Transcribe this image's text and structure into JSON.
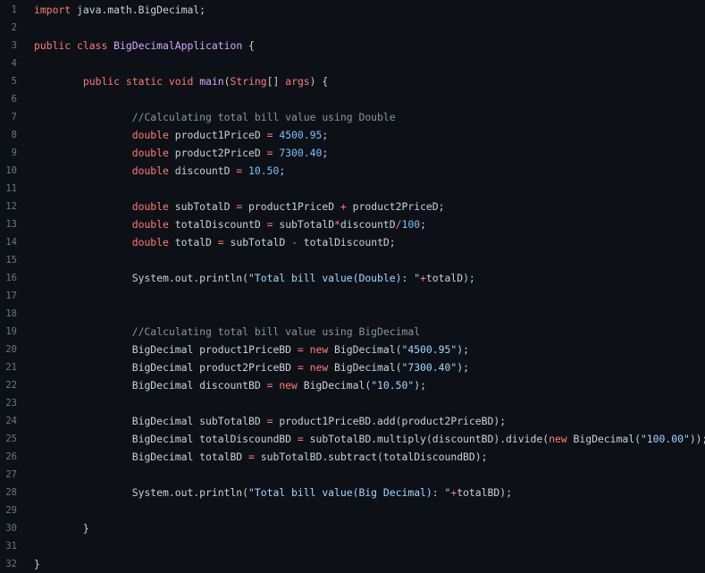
{
  "colors": {
    "background": "#0d1117",
    "text": "#c9d1d9",
    "keyword": "#ff7b72",
    "function": "#d2a8ff",
    "number": "#79c0ff",
    "string": "#a5d6ff",
    "comment": "#8b949e",
    "line_number": "#6e7681"
  },
  "lines": [
    {
      "n": "1",
      "tokens": [
        [
          "kw",
          "import"
        ],
        [
          "plain",
          " java.math.BigDecimal;"
        ]
      ]
    },
    {
      "n": "2",
      "tokens": []
    },
    {
      "n": "3",
      "tokens": [
        [
          "kw",
          "public"
        ],
        [
          "plain",
          " "
        ],
        [
          "kw",
          "class"
        ],
        [
          "plain",
          " "
        ],
        [
          "fn",
          "BigDecimalApplication"
        ],
        [
          "plain",
          " {"
        ]
      ]
    },
    {
      "n": "4",
      "tokens": []
    },
    {
      "n": "5",
      "tokens": [
        [
          "plain",
          "        "
        ],
        [
          "kw",
          "public"
        ],
        [
          "plain",
          " "
        ],
        [
          "kw",
          "static"
        ],
        [
          "plain",
          " "
        ],
        [
          "kw",
          "void"
        ],
        [
          "plain",
          " "
        ],
        [
          "fn",
          "main"
        ],
        [
          "plain",
          "("
        ],
        [
          "kw",
          "String"
        ],
        [
          "plain",
          "[] "
        ],
        [
          "kw",
          "args"
        ],
        [
          "plain",
          ") {"
        ]
      ]
    },
    {
      "n": "6",
      "tokens": []
    },
    {
      "n": "7",
      "tokens": [
        [
          "plain",
          "                "
        ],
        [
          "cm",
          "//Calculating total bill value using Double"
        ]
      ]
    },
    {
      "n": "8",
      "tokens": [
        [
          "plain",
          "                "
        ],
        [
          "kw",
          "double"
        ],
        [
          "plain",
          " product1PriceD "
        ],
        [
          "kw",
          "="
        ],
        [
          "plain",
          " "
        ],
        [
          "num",
          "4500.95"
        ],
        [
          "plain",
          ";"
        ]
      ]
    },
    {
      "n": "9",
      "tokens": [
        [
          "plain",
          "                "
        ],
        [
          "kw",
          "double"
        ],
        [
          "plain",
          " product2PriceD "
        ],
        [
          "kw",
          "="
        ],
        [
          "plain",
          " "
        ],
        [
          "num",
          "7300.40"
        ],
        [
          "plain",
          ";"
        ]
      ]
    },
    {
      "n": "10",
      "tokens": [
        [
          "plain",
          "                "
        ],
        [
          "kw",
          "double"
        ],
        [
          "plain",
          " discountD "
        ],
        [
          "kw",
          "="
        ],
        [
          "plain",
          " "
        ],
        [
          "num",
          "10.50"
        ],
        [
          "plain",
          ";"
        ]
      ]
    },
    {
      "n": "11",
      "tokens": []
    },
    {
      "n": "12",
      "tokens": [
        [
          "plain",
          "                "
        ],
        [
          "kw",
          "double"
        ],
        [
          "plain",
          " subTotalD "
        ],
        [
          "kw",
          "="
        ],
        [
          "plain",
          " product1PriceD "
        ],
        [
          "kw",
          "+"
        ],
        [
          "plain",
          " product2PriceD;"
        ]
      ]
    },
    {
      "n": "13",
      "tokens": [
        [
          "plain",
          "                "
        ],
        [
          "kw",
          "double"
        ],
        [
          "plain",
          " totalDiscountD "
        ],
        [
          "kw",
          "="
        ],
        [
          "plain",
          " subTotalD"
        ],
        [
          "kw",
          "*"
        ],
        [
          "plain",
          "discountD"
        ],
        [
          "kw",
          "/"
        ],
        [
          "num",
          "100"
        ],
        [
          "plain",
          ";"
        ]
      ]
    },
    {
      "n": "14",
      "tokens": [
        [
          "plain",
          "                "
        ],
        [
          "kw",
          "double"
        ],
        [
          "plain",
          " totalD "
        ],
        [
          "kw",
          "="
        ],
        [
          "plain",
          " subTotalD "
        ],
        [
          "kw",
          "-"
        ],
        [
          "plain",
          " totalDiscountD;"
        ]
      ]
    },
    {
      "n": "15",
      "tokens": []
    },
    {
      "n": "16",
      "tokens": [
        [
          "plain",
          "                System.out.println("
        ],
        [
          "str",
          "\"Total bill value(Double): \""
        ],
        [
          "kw",
          "+"
        ],
        [
          "plain",
          "totalD);"
        ]
      ]
    },
    {
      "n": "17",
      "tokens": []
    },
    {
      "n": "18",
      "tokens": []
    },
    {
      "n": "19",
      "tokens": [
        [
          "plain",
          "                "
        ],
        [
          "cm",
          "//Calculating total bill value using BigDecimal"
        ]
      ]
    },
    {
      "n": "20",
      "tokens": [
        [
          "plain",
          "                BigDecimal product1PriceBD "
        ],
        [
          "kw",
          "="
        ],
        [
          "plain",
          " "
        ],
        [
          "kw",
          "new"
        ],
        [
          "plain",
          " BigDecimal("
        ],
        [
          "str",
          "\"4500.95\""
        ],
        [
          "plain",
          ");"
        ]
      ]
    },
    {
      "n": "21",
      "tokens": [
        [
          "plain",
          "                BigDecimal product2PriceBD "
        ],
        [
          "kw",
          "="
        ],
        [
          "plain",
          " "
        ],
        [
          "kw",
          "new"
        ],
        [
          "plain",
          " BigDecimal("
        ],
        [
          "str",
          "\"7300.40\""
        ],
        [
          "plain",
          ");"
        ]
      ]
    },
    {
      "n": "22",
      "tokens": [
        [
          "plain",
          "                BigDecimal discountBD "
        ],
        [
          "kw",
          "="
        ],
        [
          "plain",
          " "
        ],
        [
          "kw",
          "new"
        ],
        [
          "plain",
          " BigDecimal("
        ],
        [
          "str",
          "\"10.50\""
        ],
        [
          "plain",
          ");"
        ]
      ]
    },
    {
      "n": "23",
      "tokens": []
    },
    {
      "n": "24",
      "tokens": [
        [
          "plain",
          "                BigDecimal subTotalBD "
        ],
        [
          "kw",
          "="
        ],
        [
          "plain",
          " product1PriceBD.add(product2PriceBD);"
        ]
      ]
    },
    {
      "n": "25",
      "tokens": [
        [
          "plain",
          "                BigDecimal totalDiscoundBD "
        ],
        [
          "kw",
          "="
        ],
        [
          "plain",
          " subTotalBD.multiply(discountBD).divide("
        ],
        [
          "kw",
          "new"
        ],
        [
          "plain",
          " BigDecimal("
        ],
        [
          "str",
          "\"100.00\""
        ],
        [
          "plain",
          "));"
        ]
      ]
    },
    {
      "n": "26",
      "tokens": [
        [
          "plain",
          "                BigDecimal totalBD "
        ],
        [
          "kw",
          "="
        ],
        [
          "plain",
          " subTotalBD.subtract(totalDiscoundBD);"
        ]
      ]
    },
    {
      "n": "27",
      "tokens": []
    },
    {
      "n": "28",
      "tokens": [
        [
          "plain",
          "                System.out.println("
        ],
        [
          "str",
          "\"Total bill value(Big Decimal): \""
        ],
        [
          "kw",
          "+"
        ],
        [
          "plain",
          "totalBD);"
        ]
      ]
    },
    {
      "n": "29",
      "tokens": []
    },
    {
      "n": "30",
      "tokens": [
        [
          "plain",
          "        }"
        ]
      ]
    },
    {
      "n": "31",
      "tokens": []
    },
    {
      "n": "32",
      "tokens": [
        [
          "plain",
          "}"
        ]
      ]
    }
  ]
}
